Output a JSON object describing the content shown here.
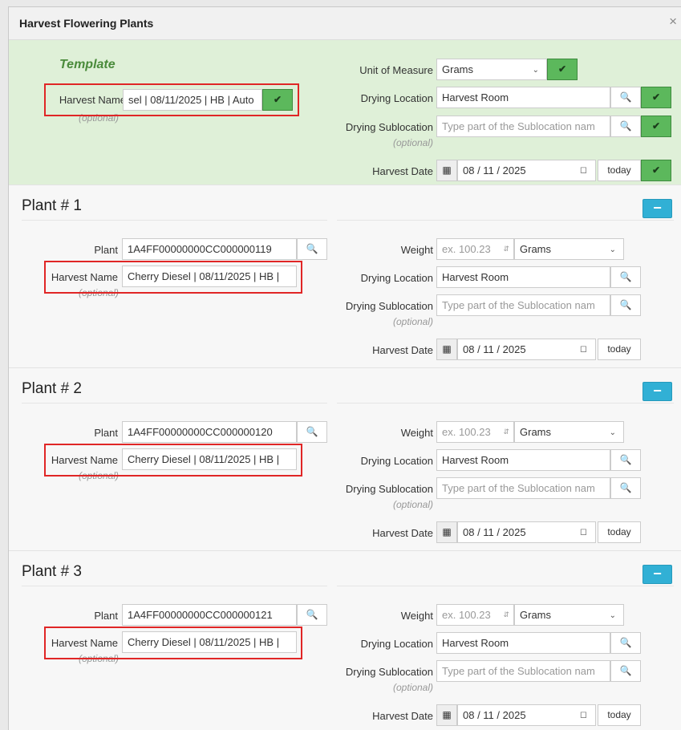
{
  "dialog": {
    "title": "Harvest Flowering Plants",
    "close": "×"
  },
  "template": {
    "title": "Template",
    "harvest_name_label": "Harvest Name",
    "harvest_name_value": "sel | 08/11/2025 | HB | Auto",
    "optional": "(optional)",
    "unit_label": "Unit of Measure",
    "unit_value": "Grams",
    "drying_location_label": "Drying Location",
    "drying_location_value": "Harvest Room",
    "drying_sublocation_label": "Drying Sublocation",
    "drying_sublocation_placeholder": "Type part of the Sublocation nam",
    "harvest_date_label": "Harvest Date",
    "harvest_date_value": "08 / 11 / 2025",
    "today_label": "today",
    "ok_glyph": "✔"
  },
  "plants": [
    {
      "title": "Plant # 1",
      "plant_label": "Plant",
      "plant_value": "1A4FF00000000CC000000119",
      "harvest_name_label": "Harvest Name",
      "harvest_name_value": "Cherry Diesel | 08/11/2025 | HB |",
      "optional": "(optional)",
      "weight_label": "Weight",
      "weight_placeholder": "ex. 100.23",
      "unit_value": "Grams",
      "drying_location_label": "Drying Location",
      "drying_location_value": "Harvest Room",
      "drying_sublocation_label": "Drying Sublocation",
      "drying_sublocation_placeholder": "Type part of the Sublocation nam",
      "sub_optional": "(optional)",
      "harvest_date_label": "Harvest Date",
      "harvest_date_value": "08 / 11 / 2025",
      "today_label": "today",
      "remove_glyph": "−"
    },
    {
      "title": "Plant # 2",
      "plant_label": "Plant",
      "plant_value": "1A4FF00000000CC000000120",
      "harvest_name_label": "Harvest Name",
      "harvest_name_value": "Cherry Diesel | 08/11/2025 | HB |",
      "optional": "(optional)",
      "weight_label": "Weight",
      "weight_placeholder": "ex. 100.23",
      "unit_value": "Grams",
      "drying_location_label": "Drying Location",
      "drying_location_value": "Harvest Room",
      "drying_sublocation_label": "Drying Sublocation",
      "drying_sublocation_placeholder": "Type part of the Sublocation nam",
      "sub_optional": "(optional)",
      "harvest_date_label": "Harvest Date",
      "harvest_date_value": "08 / 11 / 2025",
      "today_label": "today",
      "remove_glyph": "−"
    },
    {
      "title": "Plant # 3",
      "plant_label": "Plant",
      "plant_value": "1A4FF00000000CC000000121",
      "harvest_name_label": "Harvest Name",
      "harvest_name_value": "Cherry Diesel | 08/11/2025 | HB |",
      "optional": "(optional)",
      "weight_label": "Weight",
      "weight_placeholder": "ex. 100.23",
      "unit_value": "Grams",
      "drying_location_label": "Drying Location",
      "drying_location_value": "Harvest Room",
      "drying_sublocation_label": "Drying Sublocation",
      "drying_sublocation_placeholder": "Type part of the Sublocation nam",
      "sub_optional": "(optional)",
      "harvest_date_label": "Harvest Date",
      "harvest_date_value": "08 / 11 / 2025",
      "today_label": "today",
      "remove_glyph": "−"
    }
  ],
  "icons": {
    "search": "search-icon",
    "calendar": "calendar-icon",
    "calendar_picker": "calendar-picker-icon",
    "check": "check-icon",
    "chevron": "chevron-down-icon",
    "spinner": "number-spinner-icon"
  },
  "colors": {
    "template_bg": "#dff0d8",
    "template_title": "#4a8b3b",
    "ok_button": "#5cb85c",
    "remove_button": "#31b0d5",
    "highlight_box": "#e02626"
  }
}
